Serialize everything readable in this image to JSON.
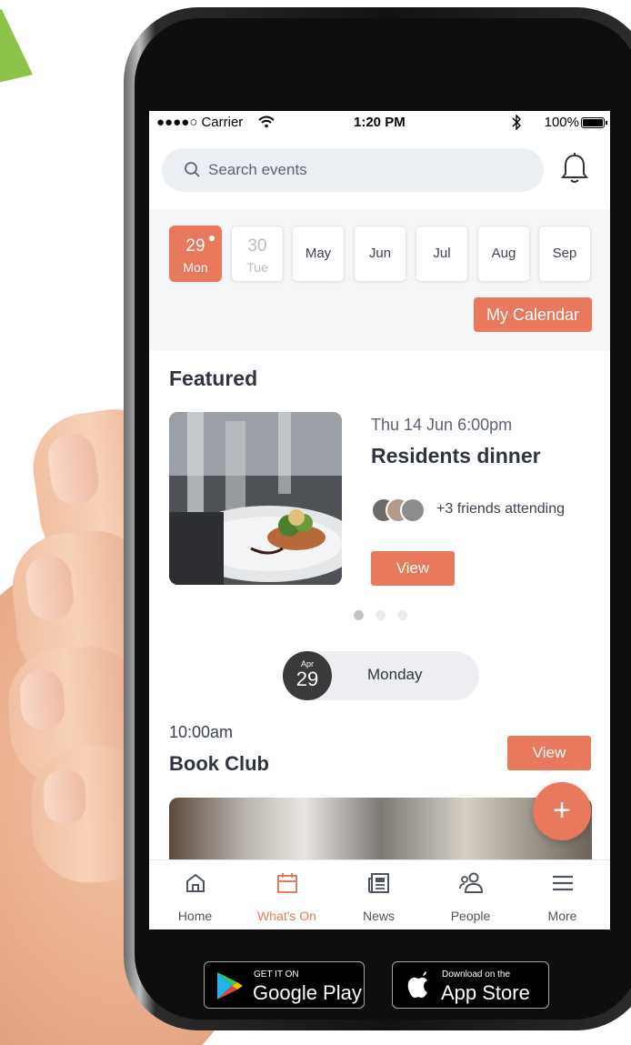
{
  "status_bar": {
    "carrier": "●●●●○ Carrier",
    "time": "1:20 PM",
    "battery": "100%"
  },
  "search": {
    "placeholder": "Search events"
  },
  "dates": [
    {
      "num": "29",
      "day": "Mon",
      "active": true
    },
    {
      "num": "30",
      "day": "Tue",
      "muted": true
    },
    {
      "label": "May"
    },
    {
      "label": "Jun"
    },
    {
      "label": "Jul"
    },
    {
      "label": "Aug"
    },
    {
      "label": "Sep"
    }
  ],
  "my_calendar_label": "My Calendar",
  "featured": {
    "title": "Featured",
    "event_date": "Thu 14 Jun 6:00pm",
    "event_name": "Residents dinner",
    "friends": "+3 friends attending",
    "view_label": "View"
  },
  "day_header": {
    "month": "Apr",
    "day": "29",
    "weekday": "Monday"
  },
  "event": {
    "time": "10:00am",
    "name": "Book Club",
    "view_label": "View"
  },
  "fab_label": "+",
  "tabs": [
    {
      "label": "Home",
      "icon": "home-icon"
    },
    {
      "label": "What's On",
      "icon": "calendar-icon",
      "active": true
    },
    {
      "label": "News",
      "icon": "newspaper-icon"
    },
    {
      "label": "People",
      "icon": "people-icon"
    },
    {
      "label": "More",
      "icon": "menu-icon"
    }
  ],
  "stores": {
    "google": {
      "small": "GET IT ON",
      "big": "Google Play"
    },
    "apple": {
      "small": "Download on the",
      "big": "App Store"
    }
  },
  "colors": {
    "accent": "#e8795c",
    "background": "#f5f6f8",
    "accent_green": "#8dc34a"
  }
}
